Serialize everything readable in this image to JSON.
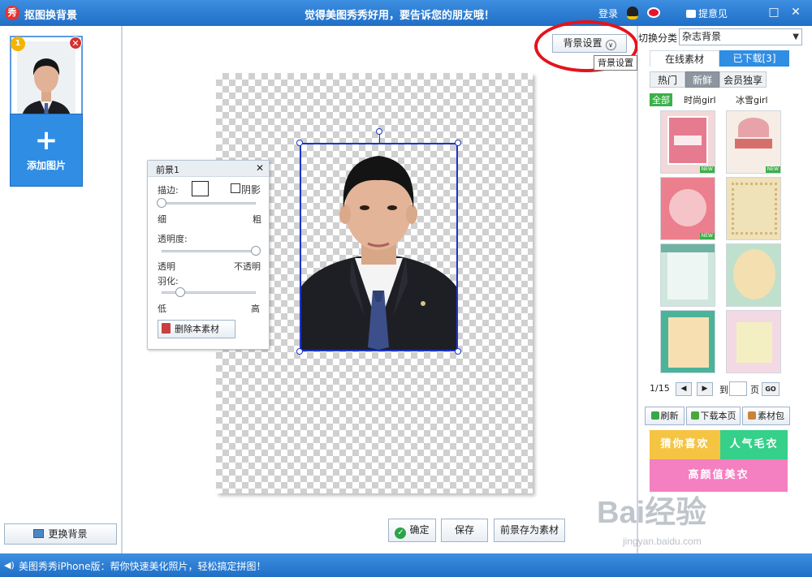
{
  "window": {
    "title": "抠图换背景",
    "slogan": "觉得美图秀秀好用，要告诉您的朋友哦！",
    "login": "登录",
    "feedback": "提意见",
    "logo_glyph": "秀"
  },
  "left": {
    "thumb_index": "1",
    "add_image": "添加图片",
    "change_bg": "更换背景"
  },
  "canvas": {
    "bg_settings": "背景设置",
    "tooltip": "背景设置",
    "confirm": "确定",
    "save": "保存",
    "save_as_material": "前景存为素材"
  },
  "fg_panel": {
    "title": "前景1",
    "stroke": "描边:",
    "shadow": "阴影",
    "thin": "细",
    "thick": "粗",
    "opacity": "透明度:",
    "transparent": "透明",
    "opaque": "不透明",
    "feather": "羽化:",
    "low": "低",
    "high": "高",
    "delete": "删除本素材",
    "stroke_level": 0.0,
    "opacity_level": 1.0,
    "feather_level": 0.2
  },
  "right": {
    "switch_label": "切换分类",
    "category": "杂志背景",
    "tab_online": "在线素材",
    "tab_downloaded": "已下载[3]",
    "sub_hot": "热门",
    "sub_new": "新鲜",
    "sub_vip": "会员独享",
    "filter_all": "全部",
    "filter_fashion": "时尚girl",
    "filter_snow": "冰雪girl",
    "new_badge": "NEW",
    "page": "1/15",
    "to": "到",
    "page_unit": "页",
    "go": "GO",
    "refresh": "刷新",
    "download_page": "下载本页",
    "material_pack": "素材包",
    "promo_1": "猜你喜欢",
    "promo_2": "人气毛衣",
    "promo_3": "高颜值美衣"
  },
  "status": {
    "text": "美图秀秀iPhone版：帮你快速美化照片，轻松搞定拼图！"
  },
  "colors": {
    "titlebar": "#2f80d8",
    "accent_blue": "#2f8de4",
    "selection": "#1b34c9",
    "highlight_circle": "#e3141c",
    "promo_yellow": "#f6c443",
    "promo_green": "#35d08a",
    "promo_pink": "#f47fc1"
  },
  "watermark": {
    "brand": "Bai经验",
    "url": "jingyan.baidu.com"
  }
}
